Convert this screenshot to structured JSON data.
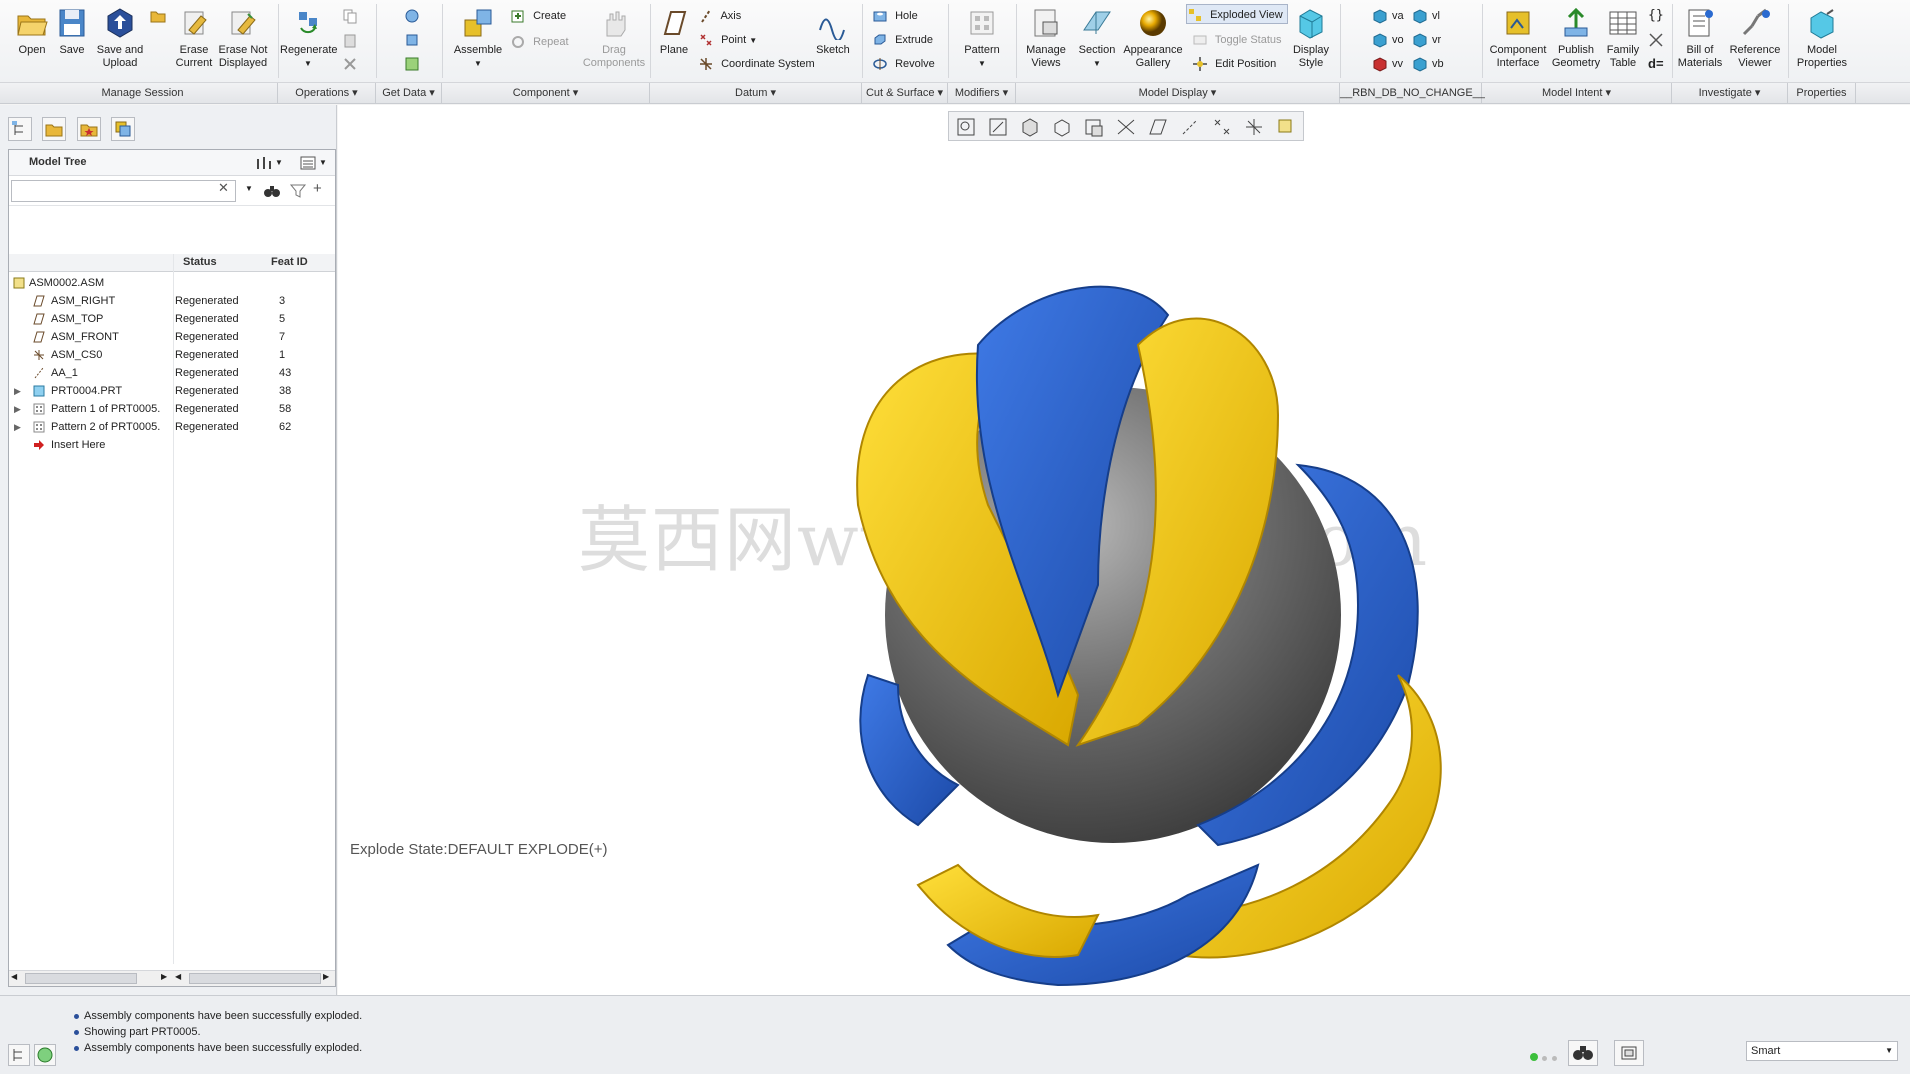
{
  "ribbon": {
    "buttons": {
      "open": "Open",
      "save": "Save",
      "save_upload": "Save and\nUpload",
      "erase_current": "Erase\nCurrent",
      "erase_not_displayed": "Erase Not\nDisplayed",
      "regenerate": "Regenerate",
      "assemble": "Assemble",
      "create": "Create",
      "repeat": "Repeat",
      "drag_components": "Drag\nComponents",
      "plane": "Plane",
      "axis": "Axis",
      "point": "Point",
      "coordinate_system": "Coordinate System",
      "sketch": "Sketch",
      "hole": "Hole",
      "extrude": "Extrude",
      "revolve": "Revolve",
      "pattern": "Pattern",
      "manage_views": "Manage\nViews",
      "section": "Section",
      "appearance_gallery": "Appearance\nGallery",
      "exploded_view": "Exploded View",
      "toggle_status": "Toggle Status",
      "edit_position": "Edit Position",
      "display_style": "Display\nStyle",
      "va": "va",
      "vl": "vl",
      "vo": "vo",
      "vr": "vr",
      "vv": "vv",
      "vb": "vb",
      "component_interface": "Component\nInterface",
      "publish_geometry": "Publish\nGeometry",
      "family_table": "Family\nTable",
      "bill_of_materials": "Bill of\nMaterials",
      "reference_viewer": "Reference\nViewer",
      "model_properties": "Model\nProperties"
    },
    "groups": [
      "Manage Session",
      "Operations ▾",
      "Get Data ▾",
      "Component ▾",
      "Datum ▾",
      "Cut & Surface ▾",
      "Modifiers ▾",
      "Model Display ▾",
      "__RBN_DB_NO_CHANGE__",
      "Model Intent ▾",
      "Investigate ▾",
      "Properties"
    ]
  },
  "tree": {
    "title": "Model Tree",
    "search_value": "",
    "col_status": "Status",
    "col_feat_id": "Feat ID",
    "rows": [
      {
        "name": "ASM0002.ASM",
        "status": "",
        "id": ""
      },
      {
        "name": "ASM_RIGHT",
        "status": "Regenerated",
        "id": "3"
      },
      {
        "name": "ASM_TOP",
        "status": "Regenerated",
        "id": "5"
      },
      {
        "name": "ASM_FRONT",
        "status": "Regenerated",
        "id": "7"
      },
      {
        "name": "ASM_CS0",
        "status": "Regenerated",
        "id": "1"
      },
      {
        "name": "AA_1",
        "status": "Regenerated",
        "id": "43"
      },
      {
        "name": "PRT0004.PRT",
        "status": "Regenerated",
        "id": "38"
      },
      {
        "name": "Pattern 1 of PRT0005.",
        "status": "Regenerated",
        "id": "58"
      },
      {
        "name": "Pattern 2 of PRT0005.",
        "status": "Regenerated",
        "id": "62"
      },
      {
        "name": "Insert Here",
        "status": "",
        "id": ""
      }
    ]
  },
  "graphics": {
    "explode_state": "Explode State:DEFAULT EXPLODE(+)",
    "watermark": "莫西网www.3dmox.com",
    "colors": {
      "yellow": "#f5c400",
      "blue": "#2f66d4",
      "gray": "#6e6e6e"
    }
  },
  "status": {
    "messages": [
      "Assembly components have been successfully exploded.",
      "Showing part PRT0005.",
      "Assembly components have been successfully exploded."
    ],
    "filter_value": "Smart"
  }
}
